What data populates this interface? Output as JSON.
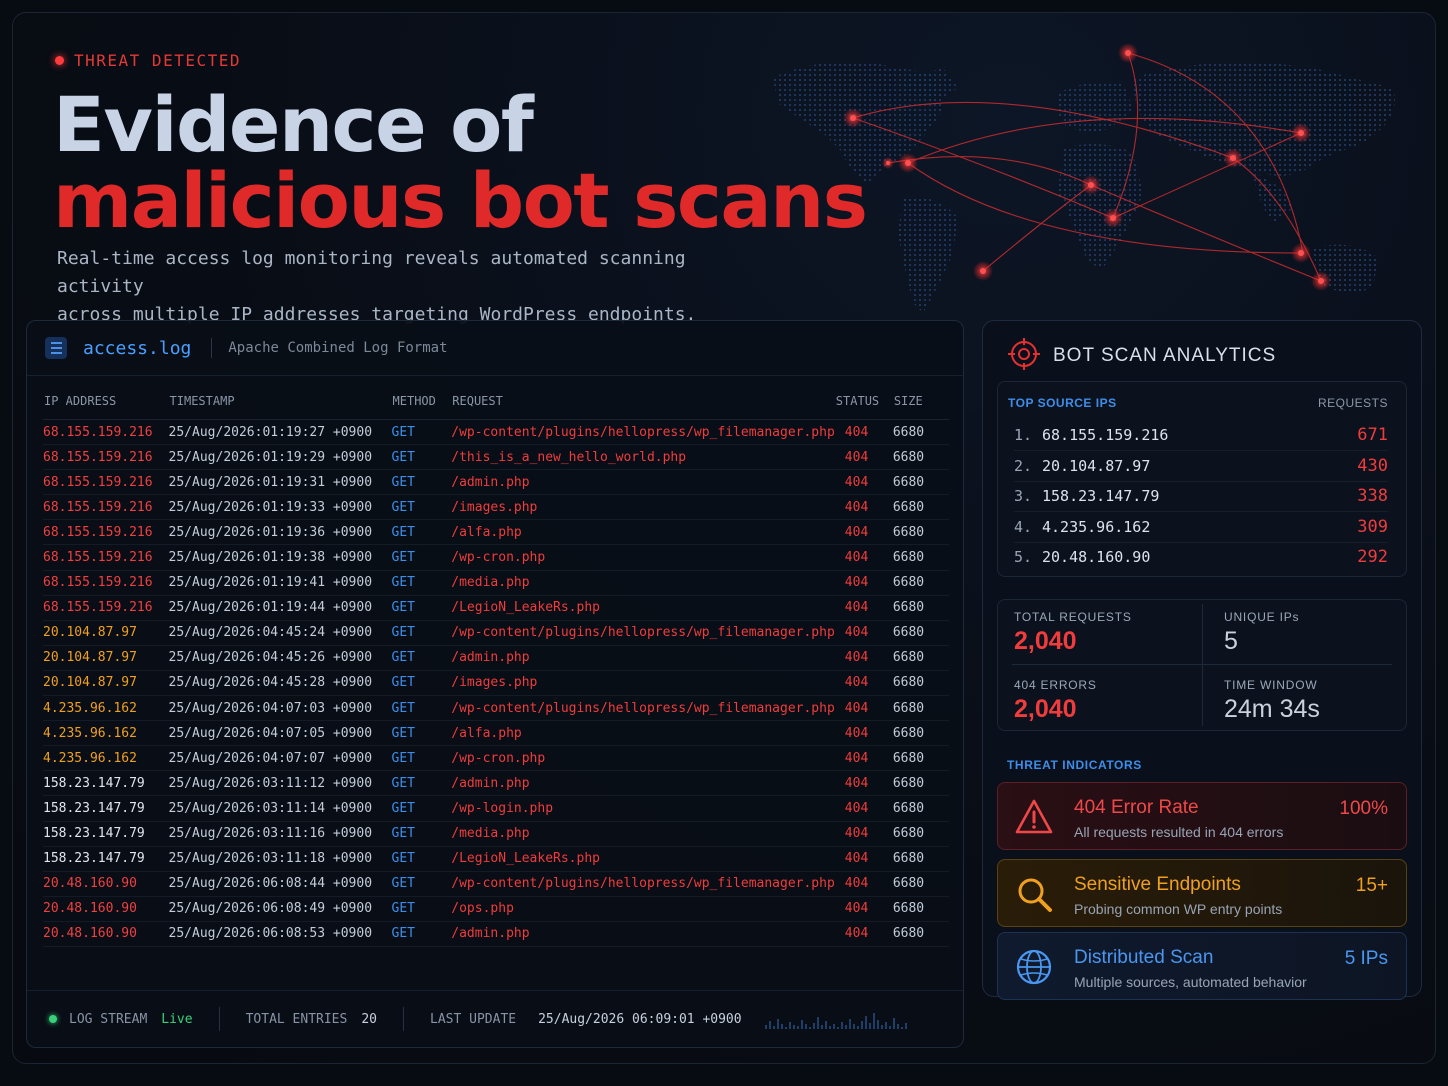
{
  "hero": {
    "badge": "THREAT DETECTED",
    "title_line1": "Evidence of",
    "title_line2": "malicious bot scans",
    "subtitle_line1": "Real-time access log monitoring reveals automated scanning activity",
    "subtitle_line2": "across multiple IP addresses targeting WordPress endpoints."
  },
  "log": {
    "file_name": "access.log",
    "format": "Apache Combined Log Format",
    "columns": [
      "IP ADDRESS",
      "TIMESTAMP",
      "METHOD",
      "REQUEST",
      "STATUS",
      "SIZE"
    ],
    "rows": [
      {
        "ip": "68.155.159.216",
        "ts": "25/Aug/2026:01:19:27 +0900",
        "method": "GET",
        "req": "/wp-content/plugins/hellopress/wp_filemanager.php",
        "status": "404",
        "size": "6680",
        "ip_color": "red"
      },
      {
        "ip": "68.155.159.216",
        "ts": "25/Aug/2026:01:19:29 +0900",
        "method": "GET",
        "req": "/this_is_a_new_hello_world.php",
        "status": "404",
        "size": "6680",
        "ip_color": "red"
      },
      {
        "ip": "68.155.159.216",
        "ts": "25/Aug/2026:01:19:31 +0900",
        "method": "GET",
        "req": "/admin.php",
        "status": "404",
        "size": "6680",
        "ip_color": "red"
      },
      {
        "ip": "68.155.159.216",
        "ts": "25/Aug/2026:01:19:33 +0900",
        "method": "GET",
        "req": "/images.php",
        "status": "404",
        "size": "6680",
        "ip_color": "red"
      },
      {
        "ip": "68.155.159.216",
        "ts": "25/Aug/2026:01:19:36 +0900",
        "method": "GET",
        "req": "/alfa.php",
        "status": "404",
        "size": "6680",
        "ip_color": "red"
      },
      {
        "ip": "68.155.159.216",
        "ts": "25/Aug/2026:01:19:38 +0900",
        "method": "GET",
        "req": "/wp-cron.php",
        "status": "404",
        "size": "6680",
        "ip_color": "red"
      },
      {
        "ip": "68.155.159.216",
        "ts": "25/Aug/2026:01:19:41 +0900",
        "method": "GET",
        "req": "/media.php",
        "status": "404",
        "size": "6680",
        "ip_color": "red"
      },
      {
        "ip": "68.155.159.216",
        "ts": "25/Aug/2026:01:19:44 +0900",
        "method": "GET",
        "req": "/LegioN_LeakeRs.php",
        "status": "404",
        "size": "6680",
        "ip_color": "red"
      },
      {
        "ip": "20.104.87.97",
        "ts": "25/Aug/2026:04:45:24 +0900",
        "method": "GET",
        "req": "/wp-content/plugins/hellopress/wp_filemanager.php",
        "status": "404",
        "size": "6680",
        "ip_color": "orange"
      },
      {
        "ip": "20.104.87.97",
        "ts": "25/Aug/2026:04:45:26 +0900",
        "method": "GET",
        "req": "/admin.php",
        "status": "404",
        "size": "6680",
        "ip_color": "orange"
      },
      {
        "ip": "20.104.87.97",
        "ts": "25/Aug/2026:04:45:28 +0900",
        "method": "GET",
        "req": "/images.php",
        "status": "404",
        "size": "6680",
        "ip_color": "orange"
      },
      {
        "ip": "4.235.96.162",
        "ts": "25/Aug/2026:04:07:03 +0900",
        "method": "GET",
        "req": "/wp-content/plugins/hellopress/wp_filemanager.php",
        "status": "404",
        "size": "6680",
        "ip_color": "orange"
      },
      {
        "ip": "4.235.96.162",
        "ts": "25/Aug/2026:04:07:05 +0900",
        "method": "GET",
        "req": "/alfa.php",
        "status": "404",
        "size": "6680",
        "ip_color": "orange"
      },
      {
        "ip": "4.235.96.162",
        "ts": "25/Aug/2026:04:07:07 +0900",
        "method": "GET",
        "req": "/wp-cron.php",
        "status": "404",
        "size": "6680",
        "ip_color": "orange"
      },
      {
        "ip": "158.23.147.79",
        "ts": "25/Aug/2026:03:11:12 +0900",
        "method": "GET",
        "req": "/admin.php",
        "status": "404",
        "size": "6680",
        "ip_color": "white"
      },
      {
        "ip": "158.23.147.79",
        "ts": "25/Aug/2026:03:11:14 +0900",
        "method": "GET",
        "req": "/wp-login.php",
        "status": "404",
        "size": "6680",
        "ip_color": "white"
      },
      {
        "ip": "158.23.147.79",
        "ts": "25/Aug/2026:03:11:16 +0900",
        "method": "GET",
        "req": "/media.php",
        "status": "404",
        "size": "6680",
        "ip_color": "white"
      },
      {
        "ip": "158.23.147.79",
        "ts": "25/Aug/2026:03:11:18 +0900",
        "method": "GET",
        "req": "/LegioN_LeakeRs.php",
        "status": "404",
        "size": "6680",
        "ip_color": "white"
      },
      {
        "ip": "20.48.160.90",
        "ts": "25/Aug/2026:06:08:44 +0900",
        "method": "GET",
        "req": "/wp-content/plugins/hellopress/wp_filemanager.php",
        "status": "404",
        "size": "6680",
        "ip_color": "red"
      },
      {
        "ip": "20.48.160.90",
        "ts": "25/Aug/2026:06:08:49 +0900",
        "method": "GET",
        "req": "/ops.php",
        "status": "404",
        "size": "6680",
        "ip_color": "red"
      },
      {
        "ip": "20.48.160.90",
        "ts": "25/Aug/2026:06:08:53 +0900",
        "method": "GET",
        "req": "/admin.php",
        "status": "404",
        "size": "6680",
        "ip_color": "red"
      }
    ],
    "footer": {
      "stream_label": "LOG STREAM",
      "stream_value": "Live",
      "entries_label": "TOTAL ENTRIES",
      "entries_value": "20",
      "update_label": "LAST UPDATE",
      "update_value": "25/Aug/2026 06:09:01 +0900"
    }
  },
  "analytics": {
    "title": "BOT SCAN ANALYTICS",
    "top_ips_label": "TOP SOURCE IPS",
    "requests_label": "REQUESTS",
    "top_ips": [
      {
        "rank": "1.",
        "ip": "68.155.159.216",
        "count": "671"
      },
      {
        "rank": "2.",
        "ip": "20.104.87.97",
        "count": "430"
      },
      {
        "rank": "3.",
        "ip": "158.23.147.79",
        "count": "338"
      },
      {
        "rank": "4.",
        "ip": "4.235.96.162",
        "count": "309"
      },
      {
        "rank": "5.",
        "ip": "20.48.160.90",
        "count": "292"
      }
    ],
    "stats": {
      "total_requests_label": "TOTAL REQUESTS",
      "total_requests": "2,040",
      "unique_ips_label": "UNIQUE IPs",
      "unique_ips": "5",
      "errors_label": "404 ERRORS",
      "errors": "2,040",
      "window_label": "TIME WINDOW",
      "window": "24m 34s"
    },
    "indicators_label": "THREAT INDICATORS",
    "indicators": [
      {
        "name": "404 Error Rate",
        "desc": "All requests resulted in 404 errors",
        "metric": "100%",
        "icon": "warning-icon"
      },
      {
        "name": "Sensitive Endpoints",
        "desc": "Probing common WP entry points",
        "metric": "15+",
        "icon": "search-icon"
      },
      {
        "name": "Distributed Scan",
        "desc": "Multiple sources, automated behavior",
        "metric": "5 IPs",
        "icon": "globe-icon"
      }
    ]
  },
  "colors": {
    "accent_red": "#f03c3c",
    "accent_orange": "#f0a020",
    "accent_blue": "#3d8eea",
    "live_green": "#3ad07a",
    "background": "#070b12"
  }
}
